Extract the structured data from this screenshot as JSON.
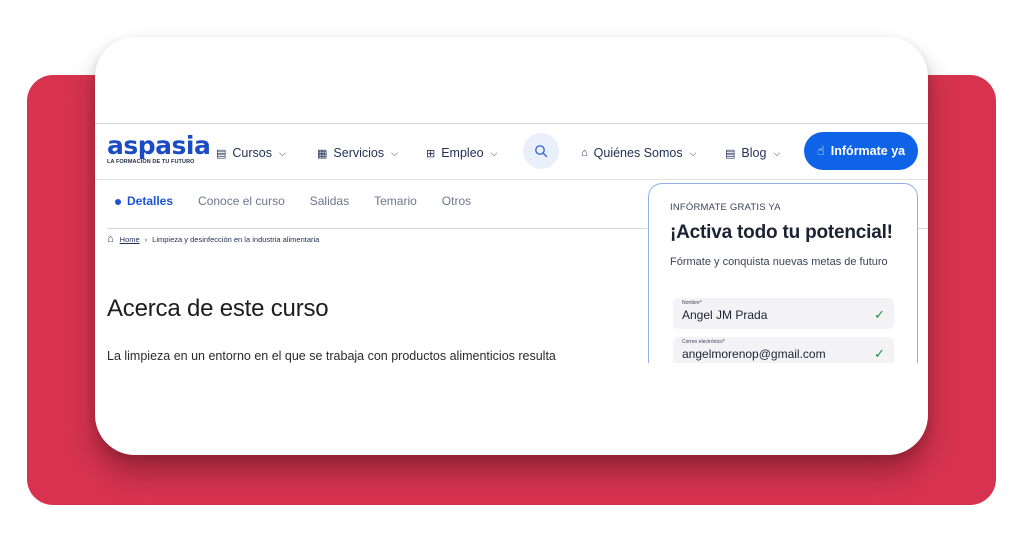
{
  "brand": {
    "logo_word": "aspasia",
    "logo_tagline": "LA FORMACIÓN DE TU FUTURO",
    "accent": "#1b55d6",
    "cta_color": "#0f63e6",
    "frame_color": "#d7334e"
  },
  "nav": {
    "cursos": "Cursos",
    "servicios": "Servicios",
    "empleo": "Empleo",
    "quienes": "Quiénes Somos",
    "blog": "Blog",
    "cta": "Infórmate ya"
  },
  "tabs": [
    "Detalles",
    "Conoce el curso",
    "Salidas",
    "Temario",
    "Otros"
  ],
  "breadcrumb": {
    "home": "Home",
    "current": "Limpieza y desinfección en la industria alimentaria"
  },
  "main": {
    "heading": "Acerca de este curso",
    "paragraph": "La limpieza en un entorno en el que se trabaja con productos alimenticios resulta"
  },
  "form": {
    "eyebrow": "INFÓRMATE GRATIS YA",
    "title": "¡Activa todo tu potencial!",
    "subtitle": "Fórmate y conquista nuevas metas de futuro",
    "fields": [
      {
        "label": "Nombre*",
        "value": "Angel JM Prada"
      },
      {
        "label": "Correo electrónico*",
        "value": "angelmorenop@gmail.com"
      }
    ]
  },
  "icons": {
    "cursos": "book-icon",
    "servicios": "grid-icon",
    "empleo": "briefcase-icon",
    "search": "search-icon",
    "quienes": "building-icon",
    "blog": "document-icon",
    "cta": "hand-pointer-icon",
    "home": "home-icon",
    "check": "check-icon"
  }
}
